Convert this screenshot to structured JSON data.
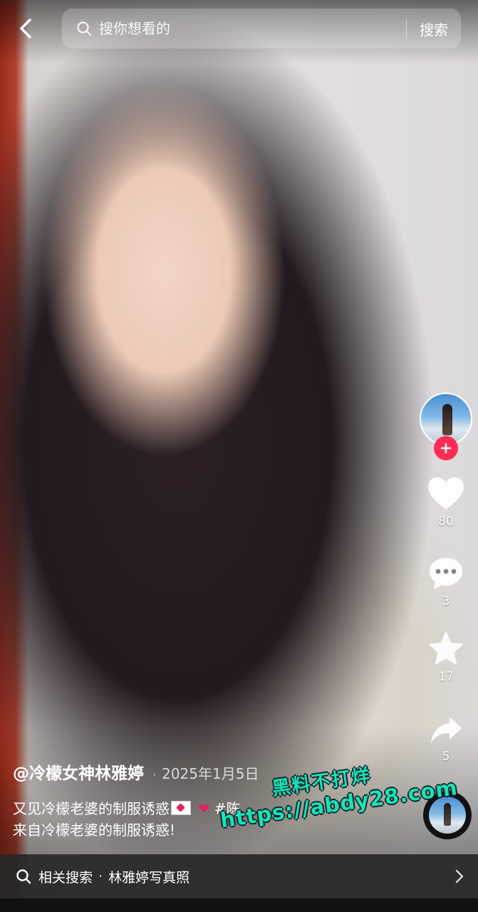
{
  "search": {
    "placeholder": "搜你想看的",
    "button_label": "搜索"
  },
  "actions": {
    "like_count": "80",
    "comment_count": "3",
    "favorite_count": "17",
    "share_count": "5"
  },
  "post": {
    "author": "@冷檬女神林雅婷",
    "separator": "·",
    "date": "2025年1月5日",
    "caption_line1_text": "又见冷檬老婆的制服诱惑",
    "caption_hashtag": "#陈",
    "caption_line2": "来自冷檬老婆的制服诱惑!"
  },
  "watermark": {
    "top": "黑料不打烊",
    "url": "https://abdy28.com"
  },
  "related_search": {
    "label": "相关搜索",
    "separator": "·",
    "term": "林雅婷写真照"
  },
  "colors": {
    "accent": "#fe2c55",
    "watermark": "#19e3b1"
  },
  "icons": [
    "back-arrow-icon",
    "search-icon",
    "plus-icon",
    "heart-icon",
    "comment-icon",
    "star-icon",
    "share-icon",
    "chevron-right-icon"
  ]
}
